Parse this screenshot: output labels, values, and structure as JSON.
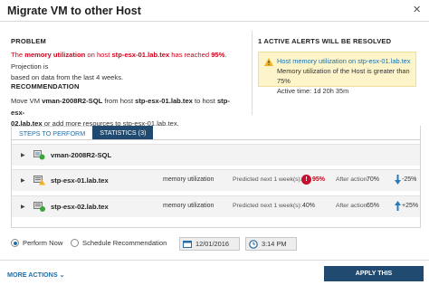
{
  "dialog": {
    "title": "Migrate VM to other Host",
    "close_glyph": "×"
  },
  "problem": {
    "heading": "PROBLEM",
    "line1_prefix": "The ",
    "line1_metric": "memory utilization",
    "line1_mid": " on host ",
    "line1_host": "stp-esx-01.lab.tex",
    "line1_mid2": " has reached ",
    "line1_value": "95%",
    "line1_suffix": ". Projection is",
    "line2": "based on data from the last 4 weeks."
  },
  "recommendation": {
    "heading": "RECOMMENDATION",
    "prefix": "Move VM ",
    "vm": "vman-2008R2-SQL",
    "mid": " from host ",
    "from_host": "stp-esx-01.lab.tex",
    "mid2": " to host ",
    "to_host_part1": "stp-esx-",
    "to_host_part2": "02.lab.tex",
    "suffix": " or add more resources to stp-esx-01.lab.tex."
  },
  "alerts": {
    "heading": "1 ACTIVE ALERTS WILL BE RESOLVED",
    "item": {
      "link": "Host memory utilization on stp-esx-01.lab.tex",
      "description": "Memory utilization of the Host is greater than 75%",
      "active_time": "Active time: 1d 20h 35m"
    },
    "colors": {
      "background": "#fdf5c9",
      "link": "#1e6fa8"
    }
  },
  "tabs": [
    {
      "label": "STEPS TO PERFORM",
      "active": false
    },
    {
      "label": "STATISTICS (3)",
      "active": true
    }
  ],
  "statistics": {
    "vm_row": {
      "name": "vman-2008R2-SQL",
      "icon": "vm-icon"
    },
    "host_rows": [
      {
        "name": "stp-esx-01.lab.tex",
        "icon": "host-warning-icon",
        "metric": "memory utilization",
        "predicted_label": "Predicted next 1 week(s):",
        "predicted_value": "95%",
        "predicted_critical": true,
        "after_label": "After action:",
        "after_value": "70%",
        "delta": "-25%",
        "delta_direction": "down"
      },
      {
        "name": "stp-esx-02.lab.tex",
        "icon": "host-ok-icon",
        "metric": "memory utilization",
        "predicted_label": "Predicted next 1 week(s):",
        "predicted_value": "40%",
        "predicted_critical": false,
        "after_label": "After action:",
        "after_value": "65%",
        "delta": "+25%",
        "delta_direction": "up"
      }
    ]
  },
  "schedule": {
    "perform_now": "Perform Now",
    "schedule_recommendation": "Schedule Recommendation",
    "selected": "perform_now",
    "date": "12/01/2016",
    "time": "3:14 PM"
  },
  "footer": {
    "more_actions": "MORE ACTIONS",
    "apply": "APPLY THIS RECOMMENDATION"
  },
  "colors": {
    "accent_dark": "#204a6f",
    "link": "#1e6fa8",
    "danger": "#d0021b",
    "ok": "#3aa53a"
  }
}
